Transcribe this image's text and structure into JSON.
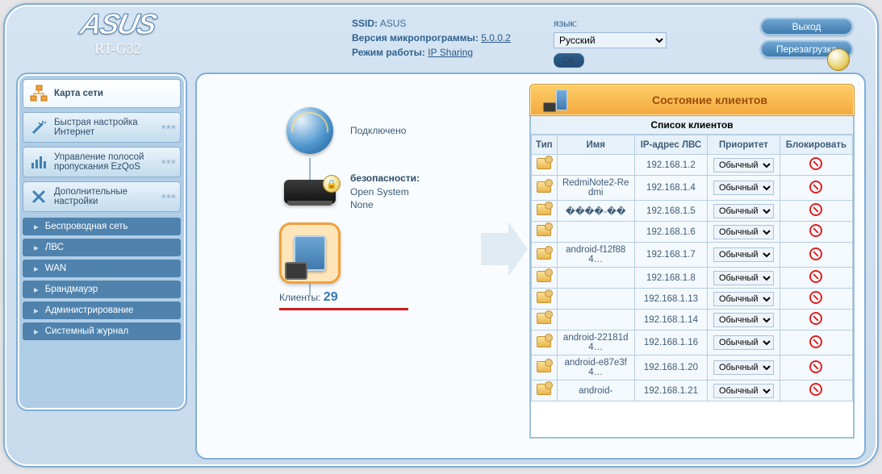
{
  "brand": {
    "logo_text": "ASUS",
    "model": "RT-G32"
  },
  "header": {
    "ssid_label": "SSID:",
    "ssid_value": "ASUS",
    "fw_label": "Версия микропрограммы:",
    "fw_value": "5.0.0.2",
    "mode_label": "Режим работы:",
    "mode_value": "IP Sharing",
    "lang_label": "язык:",
    "lang_value": "Русский",
    "ok": "OK",
    "logout": "Выход",
    "reboot": "Перезагрузка"
  },
  "sidebar": {
    "main": [
      {
        "label": "Карта сети"
      },
      {
        "label": "Быстрая настройка Интернет"
      },
      {
        "label": "Управление полосой пропускания EzQoS"
      },
      {
        "label": "Дополнительные настройки"
      }
    ],
    "sub": [
      {
        "label": "Беспроводная сеть"
      },
      {
        "label": "ЛВС"
      },
      {
        "label": "WAN"
      },
      {
        "label": "Брандмауэр"
      },
      {
        "label": "Администрирование"
      },
      {
        "label": "Системный журнал"
      }
    ]
  },
  "topology": {
    "internet_status": "Подключено",
    "security_label": "безопасности:",
    "security_mode": "Open System",
    "security_enc": "None",
    "clients_label": "Клиенты:",
    "clients_count": "29"
  },
  "panel": {
    "title": "Состояние клиентов",
    "list_caption": "Список клиентов",
    "cols": {
      "type": "Тип",
      "name": "Имя",
      "ip": "IP-адрес ЛВС",
      "prio": "Приоритет",
      "block": "Блокировать"
    },
    "priority_option": "Обычный",
    "rows": [
      {
        "name": "",
        "ip": "192.168.1.2"
      },
      {
        "name": "RedmiNote2-Redmi",
        "ip": "192.168.1.4"
      },
      {
        "name": "����-��",
        "ip": "192.168.1.5"
      },
      {
        "name": "",
        "ip": "192.168.1.6"
      },
      {
        "name": "android-f12f884…",
        "ip": "192.168.1.7"
      },
      {
        "name": "",
        "ip": "192.168.1.8"
      },
      {
        "name": "",
        "ip": "192.168.1.13"
      },
      {
        "name": "",
        "ip": "192.168.1.14"
      },
      {
        "name": "android-22181d4…",
        "ip": "192.168.1.16"
      },
      {
        "name": "android-e87e3f4…",
        "ip": "192.168.1.20"
      },
      {
        "name": "android-",
        "ip": "192.168.1.21"
      }
    ]
  }
}
